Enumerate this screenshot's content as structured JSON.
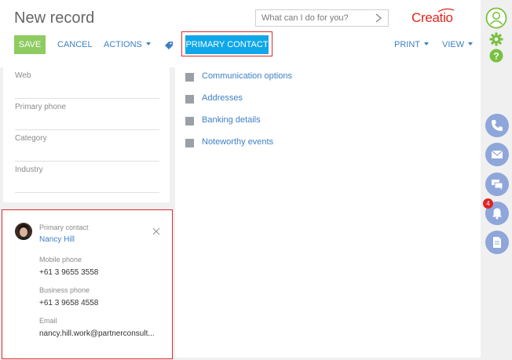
{
  "header": {
    "title": "New record",
    "search_placeholder": "What can I do for you?",
    "logo_text": "Creatio"
  },
  "toolbar": {
    "save_label": "SAVE",
    "cancel_label": "CANCEL",
    "actions_label": "ACTIONS",
    "primary_contact_label": "PRIMARY CONTACT",
    "print_label": "PRINT",
    "view_label": "VIEW"
  },
  "fields": [
    {
      "label": "Web",
      "value": ""
    },
    {
      "label": "Primary phone",
      "value": ""
    },
    {
      "label": "Category",
      "value": ""
    },
    {
      "label": "Industry",
      "value": ""
    }
  ],
  "groups": [
    {
      "label": "Communication options"
    },
    {
      "label": "Addresses"
    },
    {
      "label": "Banking details"
    },
    {
      "label": "Noteworthy events"
    }
  ],
  "contact_card": {
    "role_label": "Primary contact",
    "name": "Nancy Hill",
    "mobile_label": "Mobile phone",
    "mobile_value": "+61 3 9655 3558",
    "business_label": "Business phone",
    "business_value": "+61 3 9658 4558",
    "email_label": "Email",
    "email_value": "nancy.hill.work@partnerconsult..."
  },
  "rail": {
    "notification_count": "4"
  },
  "colors": {
    "accent_blue": "#0fa7e8",
    "save_green": "#8ecb60",
    "link_blue": "#3f7fc5",
    "highlight_red": "#e0282c",
    "brand_red": "#e1261c",
    "rail_green": "#7ac142",
    "rail_blue": "#8ea6d9"
  },
  "icons": [
    "search-icon",
    "chevron-right-icon",
    "tag-icon",
    "close-icon",
    "user-profile-icon",
    "gear-icon",
    "help-icon",
    "phone-icon",
    "email-icon",
    "chat-icon",
    "bell-icon",
    "document-icon"
  ]
}
